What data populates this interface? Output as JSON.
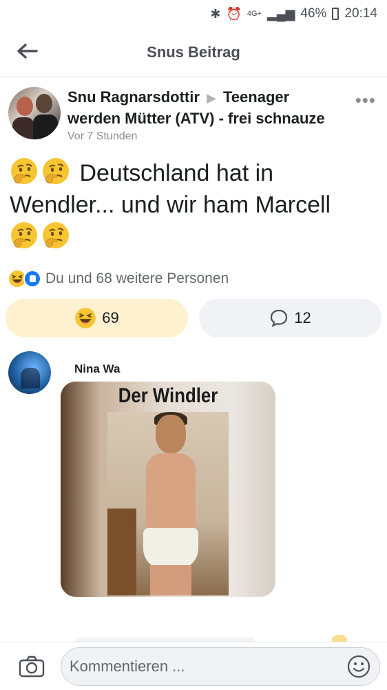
{
  "status_bar": {
    "bluetooth_icon": "bluetooth-icon",
    "alarm_icon": "alarm-icon",
    "network": "4G+",
    "signal_icon": "signal-icon",
    "battery": "46%",
    "time": "20:14"
  },
  "header": {
    "title": "Snus Beitrag",
    "back_icon": "arrow-left-icon"
  },
  "post": {
    "author": "Snu Ragnarsdottir",
    "separator_icon": "▶",
    "group": "Teenager werden Mütter (ATV) - frei schnauze",
    "time": "Vor 7 Stunden",
    "more_icon": "•••",
    "text": "Deutschland hat in Wendler... und wir ham Marcell",
    "emoji_icon": "thinking-face-emoji"
  },
  "reactions": {
    "summary": "Du und 68 weitere Personen",
    "icons": [
      "haha-reaction-icon",
      "like-reaction-icon"
    ]
  },
  "actions": {
    "haha_count": "69",
    "comment_count": "12"
  },
  "comment": {
    "name": "Nina Wa",
    "image_title": "Der Windler"
  },
  "composer": {
    "placeholder": "Kommentieren ...",
    "camera_icon": "camera-icon",
    "emoji_icon": "smiley-icon"
  },
  "colors": {
    "haha_bg": "#fdf1d0",
    "comment_bg": "#f0f2f5",
    "like_blue": "#1877f2",
    "emoji_yellow": "#f7c531"
  }
}
